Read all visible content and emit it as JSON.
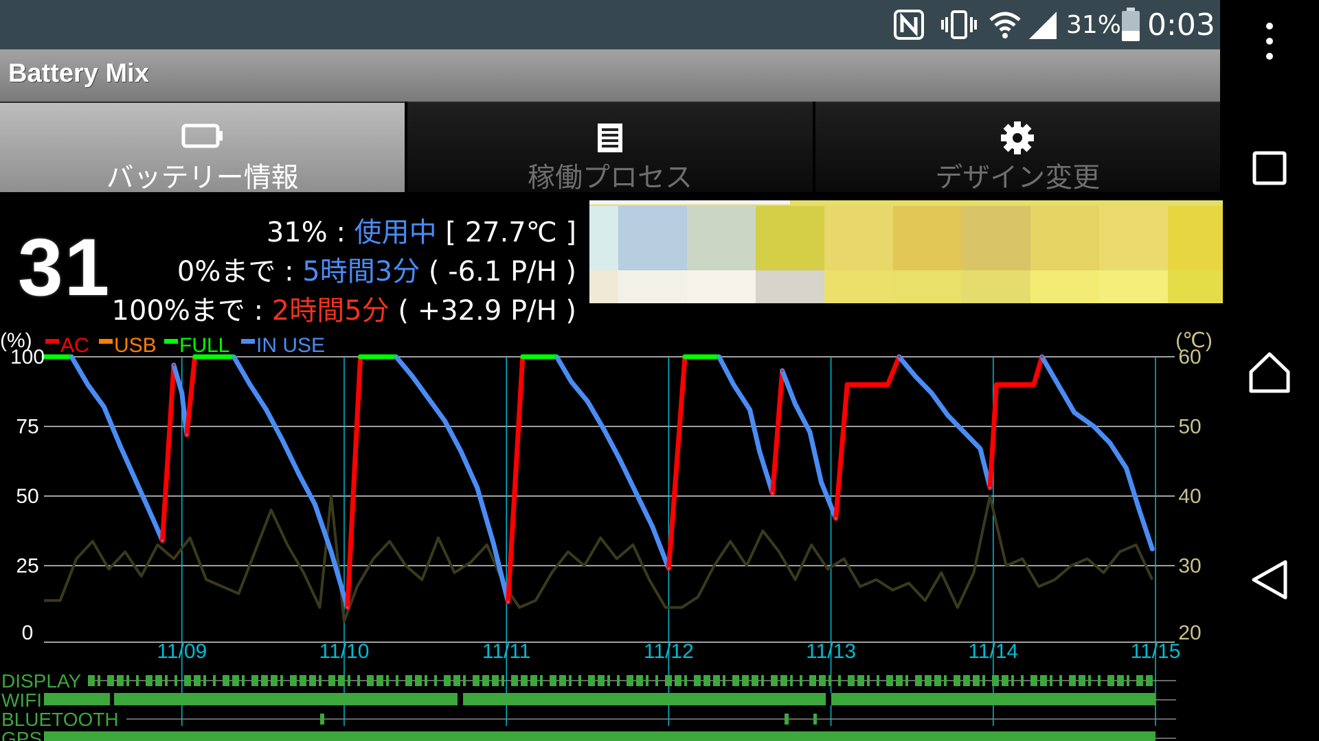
{
  "status_bar": {
    "battery_percent": "31%",
    "time": "0:03",
    "icons": [
      "nfc-icon",
      "vibrate-icon",
      "wifi-icon",
      "cell-signal-icon",
      "battery-icon"
    ]
  },
  "nav_bar": {
    "icons": [
      "overflow-menu-icon",
      "recents-icon",
      "home-icon",
      "back-icon"
    ]
  },
  "app": {
    "title": "Battery Mix"
  },
  "tabs": [
    {
      "label": "バッテリー情報",
      "icon": "battery-icon",
      "active": true
    },
    {
      "label": "稼働プロセス",
      "icon": "list-icon",
      "active": false
    },
    {
      "label": "デザイン変更",
      "icon": "gear-icon",
      "active": false
    }
  ],
  "battery_info": {
    "big_percent": "31",
    "status": {
      "level": "31%",
      "sep": " : ",
      "state": "使用中",
      "temp": " [ 27.7℃ ]"
    },
    "to_empty": {
      "label": "0%まで",
      "sep": " : ",
      "time": "5時間3分",
      "rate": " ( -6.1 P/H )"
    },
    "to_full": {
      "label": "100%まで",
      "sep": " : ",
      "time": "2時間5分",
      "rate": " ( +32.9 P/H )"
    }
  },
  "colors": {
    "in_use": "#4a8cf5",
    "ac": "#ff0000",
    "usb": "#ff7f00",
    "full": "#00ff00",
    "temperature": "#3a3a1c",
    "time_bar": "#3ca83c",
    "grid_vertical": "#00bcd4"
  },
  "chart_data": {
    "type": "line",
    "y_left_label": "(%)",
    "y_right_label": "(℃)",
    "y_left_ticks": [
      "100",
      "75",
      "50",
      "25",
      "0"
    ],
    "y_right_ticks": [
      "60",
      "50",
      "40",
      "30",
      "20"
    ],
    "ylim_left": [
      0,
      100
    ],
    "ylim_right": [
      20,
      60
    ],
    "x_ticks": [
      "11/09",
      "11/10",
      "11/11",
      "11/12",
      "11/13",
      "11/14",
      "11/15"
    ],
    "xlim_days": [
      8.15,
      15.0
    ],
    "grid": true,
    "legend": {
      "placement": "top-left",
      "entries": [
        "AC",
        "USB",
        "FULL",
        "IN USE"
      ]
    },
    "battery_series": {
      "name": "battery",
      "points": [
        [
          8.15,
          100,
          "full"
        ],
        [
          8.32,
          100,
          "full"
        ],
        [
          8.42,
          90,
          "use"
        ],
        [
          8.52,
          82,
          "use"
        ],
        [
          8.62,
          68,
          "use"
        ],
        [
          8.72,
          55,
          "use"
        ],
        [
          8.82,
          42,
          "use"
        ],
        [
          8.88,
          34,
          "use"
        ],
        [
          8.95,
          97,
          "ac"
        ],
        [
          9.0,
          87,
          "use"
        ],
        [
          9.03,
          72,
          "use"
        ],
        [
          9.08,
          100,
          "ac"
        ],
        [
          9.08,
          100,
          "full"
        ],
        [
          9.32,
          100,
          "full"
        ],
        [
          9.42,
          90,
          "use"
        ],
        [
          9.52,
          81,
          "use"
        ],
        [
          9.62,
          70,
          "use"
        ],
        [
          9.72,
          58,
          "use"
        ],
        [
          9.82,
          47,
          "use"
        ],
        [
          9.92,
          30,
          "use"
        ],
        [
          10.02,
          10,
          "use"
        ],
        [
          10.1,
          100,
          "ac"
        ],
        [
          10.1,
          100,
          "full"
        ],
        [
          10.32,
          100,
          "full"
        ],
        [
          10.42,
          93,
          "use"
        ],
        [
          10.52,
          85,
          "use"
        ],
        [
          10.62,
          77,
          "use"
        ],
        [
          10.72,
          66,
          "use"
        ],
        [
          10.82,
          53,
          "use"
        ],
        [
          10.92,
          33,
          "use"
        ],
        [
          11.01,
          12,
          "use"
        ],
        [
          11.1,
          100,
          "ac"
        ],
        [
          11.1,
          100,
          "full"
        ],
        [
          11.31,
          100,
          "full"
        ],
        [
          11.4,
          91,
          "use"
        ],
        [
          11.5,
          84,
          "use"
        ],
        [
          11.6,
          74,
          "use"
        ],
        [
          11.7,
          63,
          "use"
        ],
        [
          11.8,
          51,
          "use"
        ],
        [
          11.9,
          39,
          "use"
        ],
        [
          12.0,
          24,
          "use"
        ],
        [
          12.1,
          100,
          "ac"
        ],
        [
          12.1,
          100,
          "full"
        ],
        [
          12.31,
          100,
          "full"
        ],
        [
          12.4,
          90,
          "use"
        ],
        [
          12.5,
          81,
          "use"
        ],
        [
          12.56,
          66,
          "use"
        ],
        [
          12.64,
          51,
          "use"
        ],
        [
          12.7,
          95,
          "ac"
        ],
        [
          12.78,
          83,
          "use"
        ],
        [
          12.87,
          73,
          "use"
        ],
        [
          12.94,
          55,
          "use"
        ],
        [
          13.03,
          42,
          "use"
        ],
        [
          13.1,
          90,
          "ac"
        ],
        [
          13.35,
          90,
          "ac"
        ],
        [
          13.42,
          100,
          "ac"
        ],
        [
          13.52,
          93,
          "use"
        ],
        [
          13.62,
          87,
          "use"
        ],
        [
          13.72,
          79,
          "use"
        ],
        [
          13.82,
          73,
          "use"
        ],
        [
          13.92,
          67,
          "use"
        ],
        [
          13.98,
          53,
          "use"
        ],
        [
          14.02,
          90,
          "ac"
        ],
        [
          14.25,
          90,
          "ac"
        ],
        [
          14.3,
          100,
          "ac"
        ],
        [
          14.4,
          90,
          "use"
        ],
        [
          14.5,
          80,
          "use"
        ],
        [
          14.62,
          75,
          "use"
        ],
        [
          14.72,
          69,
          "use"
        ],
        [
          14.82,
          60,
          "use"
        ],
        [
          14.9,
          45,
          "use"
        ],
        [
          14.98,
          31,
          "use"
        ]
      ]
    },
    "temperature_series": {
      "name": "temperature",
      "points": [
        [
          8.15,
          25.0
        ],
        [
          8.25,
          25.0
        ],
        [
          8.35,
          31.0
        ],
        [
          8.45,
          33.5
        ],
        [
          8.55,
          29.5
        ],
        [
          8.65,
          32.0
        ],
        [
          8.75,
          28.5
        ],
        [
          8.85,
          33.0
        ],
        [
          8.95,
          31.0
        ],
        [
          9.05,
          34.0
        ],
        [
          9.15,
          28.0
        ],
        [
          9.25,
          27.0
        ],
        [
          9.35,
          26.0
        ],
        [
          9.45,
          32.0
        ],
        [
          9.55,
          38.0
        ],
        [
          9.65,
          33.0
        ],
        [
          9.75,
          29.0
        ],
        [
          9.85,
          24.0
        ],
        [
          9.92,
          40.0
        ],
        [
          10.0,
          22.0
        ],
        [
          10.08,
          27.0
        ],
        [
          10.18,
          31.0
        ],
        [
          10.28,
          33.5
        ],
        [
          10.38,
          30.0
        ],
        [
          10.48,
          28.0
        ],
        [
          10.58,
          34.0
        ],
        [
          10.68,
          29.0
        ],
        [
          10.78,
          30.5
        ],
        [
          10.88,
          33.0
        ],
        [
          10.98,
          27.5
        ],
        [
          11.08,
          24.0
        ],
        [
          11.18,
          25.0
        ],
        [
          11.28,
          29.0
        ],
        [
          11.38,
          32.0
        ],
        [
          11.48,
          30.0
        ],
        [
          11.58,
          34.0
        ],
        [
          11.68,
          31.0
        ],
        [
          11.78,
          33.0
        ],
        [
          11.88,
          28.0
        ],
        [
          11.98,
          24.0
        ],
        [
          12.08,
          24.0
        ],
        [
          12.18,
          25.5
        ],
        [
          12.28,
          30.0
        ],
        [
          12.38,
          33.5
        ],
        [
          12.48,
          30.0
        ],
        [
          12.58,
          35.0
        ],
        [
          12.68,
          32.0
        ],
        [
          12.78,
          28.0
        ],
        [
          12.88,
          33.0
        ],
        [
          12.98,
          29.5
        ],
        [
          13.08,
          31.0
        ],
        [
          13.18,
          27.0
        ],
        [
          13.28,
          28.0
        ],
        [
          13.38,
          26.5
        ],
        [
          13.48,
          27.5
        ],
        [
          13.58,
          25.0
        ],
        [
          13.68,
          29.0
        ],
        [
          13.78,
          24.0
        ],
        [
          13.88,
          29.0
        ],
        [
          13.98,
          40.0
        ],
        [
          14.08,
          30.0
        ],
        [
          14.18,
          31.0
        ],
        [
          14.28,
          27.0
        ],
        [
          14.38,
          28.0
        ],
        [
          14.48,
          30.0
        ],
        [
          14.58,
          31.0
        ],
        [
          14.68,
          29.0
        ],
        [
          14.78,
          32.0
        ],
        [
          14.88,
          33.0
        ],
        [
          14.98,
          28.0
        ]
      ]
    },
    "time_bars": [
      {
        "label": "DISPLAY"
      },
      {
        "label": "WIFI"
      },
      {
        "label": "BLUETOOTH"
      },
      {
        "label": "GPS"
      }
    ]
  }
}
